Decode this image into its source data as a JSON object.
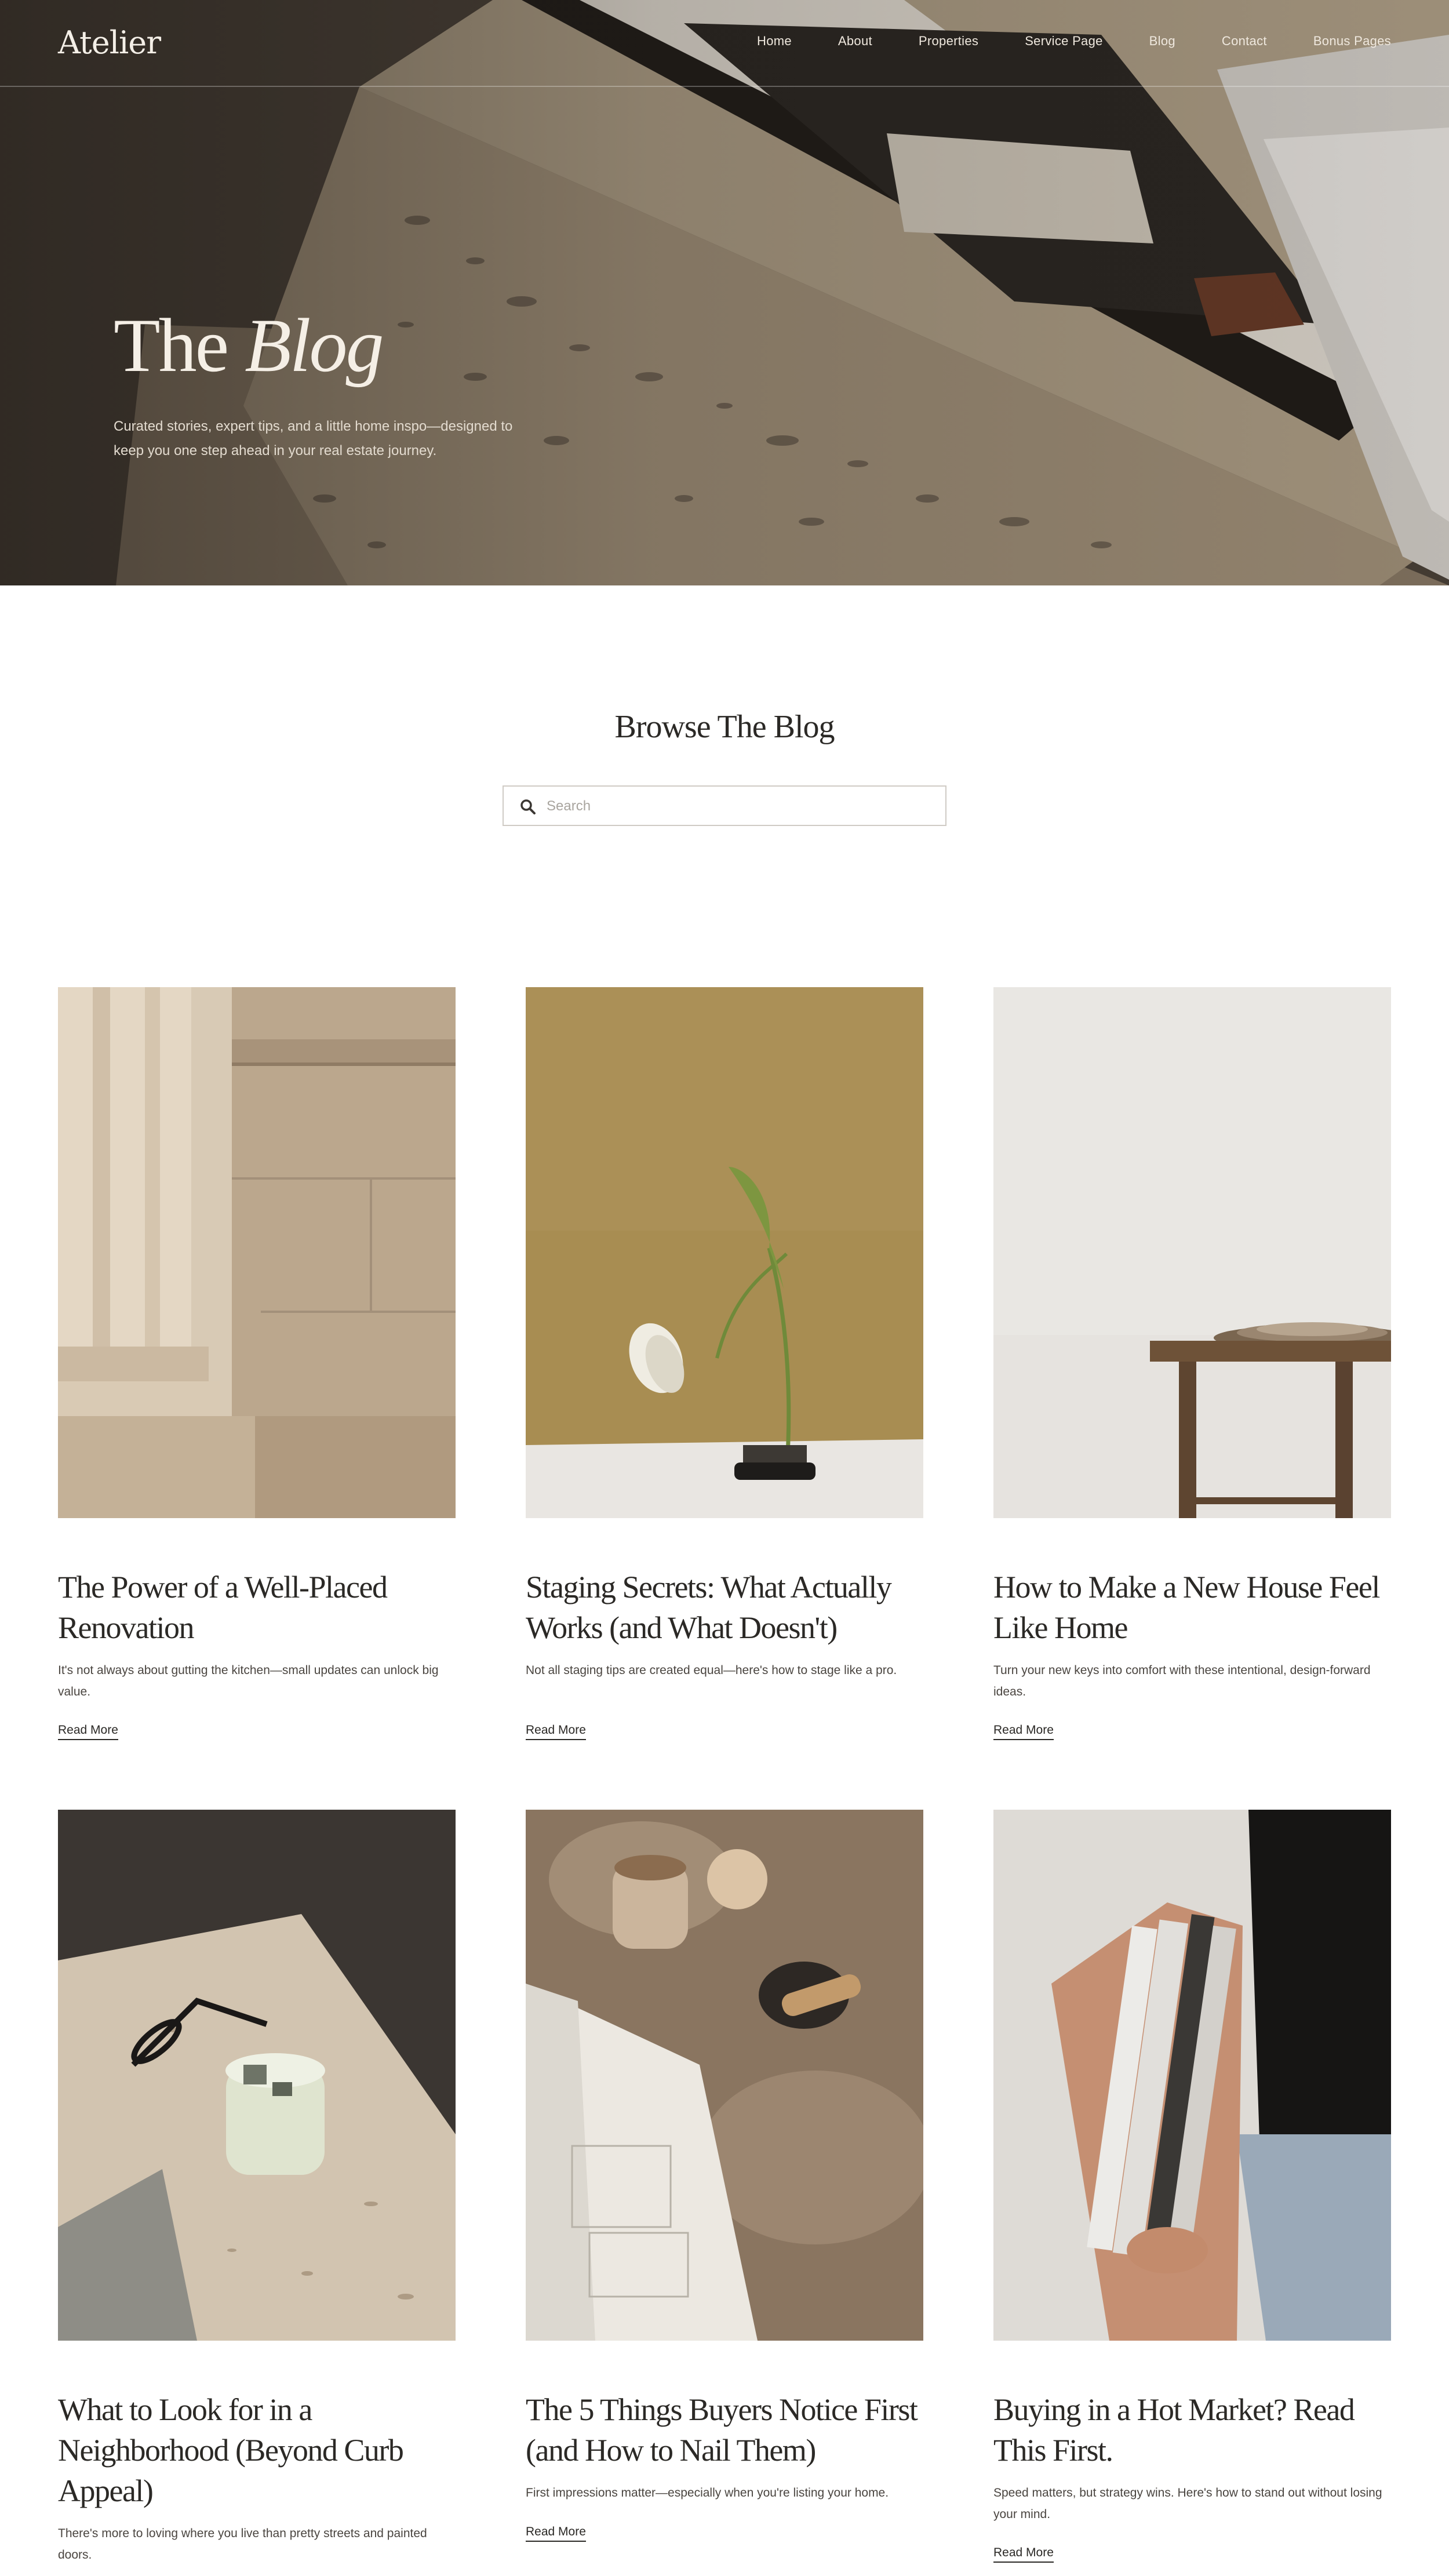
{
  "header": {
    "logo": "Atelier",
    "nav": [
      "Home",
      "About",
      "Properties",
      "Service Page",
      "Blog",
      "Contact",
      "Bonus Pages"
    ]
  },
  "hero": {
    "title_plain": "The ",
    "title_italic": "Blog",
    "subtitle": "Curated stories, expert tips, and a little home inspo—designed to keep you one step ahead in your real estate journey."
  },
  "browse": {
    "title": "Browse The Blog",
    "search_placeholder": "Search",
    "search_value": ""
  },
  "posts": [
    {
      "title": "The Power of a Well-Placed Renovation",
      "excerpt": "It's not always about gutting the kitchen—small updates can unlock big value.",
      "link": "Read More",
      "image": "stone-column-wall"
    },
    {
      "title": "Staging Secrets: What Actually Works (and What Doesn't)",
      "excerpt": "Not all staging tips are created equal—here's how to stage like a pro.",
      "link": "Read More",
      "image": "tulip-on-olive-wall"
    },
    {
      "title": "How to Make a New House Feel Like Home",
      "excerpt": "Turn your new keys into comfort with these intentional, design-forward ideas.",
      "link": "Read More",
      "image": "bowls-on-wooden-stool"
    },
    {
      "title": "What to Look for in a Neighborhood (Beyond Curb Appeal)",
      "excerpt": "There's more to loving where you live than pretty streets and painted doors.",
      "link": "Read More",
      "image": "candle-and-sunglasses-on-travertine"
    },
    {
      "title": "The 5 Things Buyers Notice First (and How to Nail Them)",
      "excerpt": "First impressions matter—especially when you're listing your home.",
      "link": "Read More",
      "image": "notebook-and-cup-on-marble"
    },
    {
      "title": "Buying in a Hot Market? Read This First.",
      "excerpt": "Speed matters, but strategy wins. Here's how to stand out without losing your mind.",
      "link": "Read More",
      "image": "woman-holding-books"
    }
  ]
}
